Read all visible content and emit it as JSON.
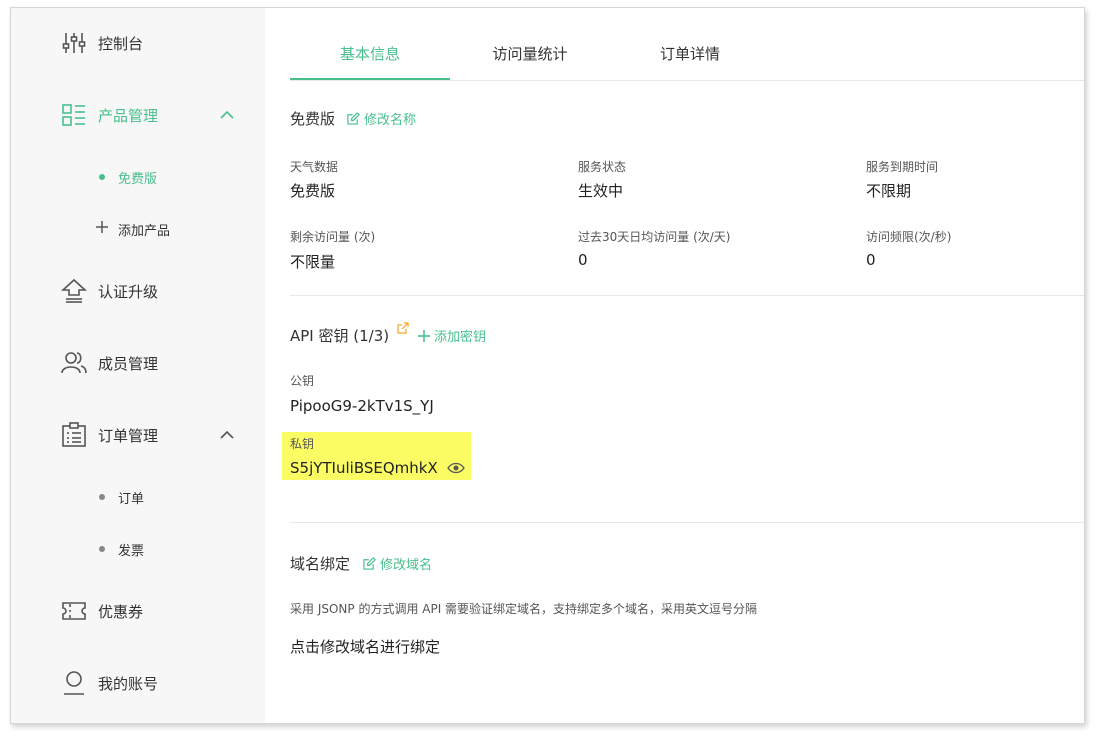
{
  "sidebar": {
    "items": [
      {
        "label": "控制台",
        "icon": "sliders-icon"
      },
      {
        "label": "产品管理",
        "icon": "grid-list-icon"
      },
      {
        "label": "认证升级",
        "icon": "upgrade-icon"
      },
      {
        "label": "成员管理",
        "icon": "members-icon"
      },
      {
        "label": "订单管理",
        "icon": "clipboard-icon"
      },
      {
        "label": "优惠券",
        "icon": "ticket-icon"
      },
      {
        "label": "我的账号",
        "icon": "user-icon"
      }
    ],
    "product_sub": [
      {
        "label": "免费版"
      },
      {
        "label": "添加产品"
      }
    ],
    "order_sub": [
      {
        "label": "订单"
      },
      {
        "label": "发票"
      }
    ]
  },
  "tabs": [
    {
      "label": "基本信息"
    },
    {
      "label": "访问量统计"
    },
    {
      "label": "订单详情"
    }
  ],
  "basic": {
    "title": "免费版",
    "rename_link": "修改名称",
    "fields": [
      {
        "label": "天气数据",
        "value": "免费版"
      },
      {
        "label": "服务状态",
        "value": "生效中"
      },
      {
        "label": "服务到期时间",
        "value": "不限期"
      },
      {
        "label": "剩余访问量 (次)",
        "value": "不限量"
      },
      {
        "label": "过去30天日均访问量 (次/天)",
        "value": "0"
      },
      {
        "label": "访问频限(次/秒)",
        "value": "0"
      }
    ]
  },
  "api": {
    "title": "API 密钥 (1/3)",
    "add_key_link": "添加密钥",
    "public_label": "公钥",
    "public_value": "PipooG9-2kTv1S_YJ",
    "private_label": "私钥",
    "private_value": "S5jYTIuliBSEQmhkX"
  },
  "domain": {
    "title": "域名绑定",
    "edit_link": "修改域名",
    "desc": "采用 JSONP 的方式调用 API 需要验证绑定域名，支持绑定多个域名，采用英文逗号分隔",
    "placeholder": "点击修改域名进行绑定"
  },
  "colors": {
    "accent": "#48c08d",
    "highlight": "#fbfc64",
    "external": "#f5a623"
  }
}
